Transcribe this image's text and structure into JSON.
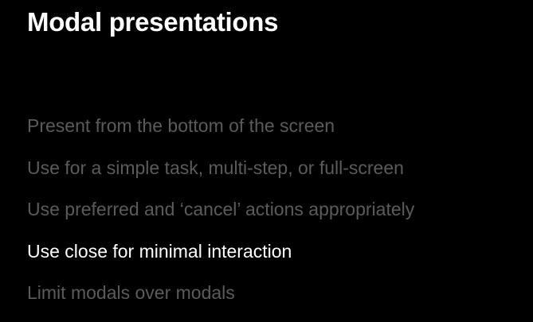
{
  "title": "Modal presentations",
  "bullets": [
    {
      "text": "Present from the bottom of the screen",
      "highlighted": false
    },
    {
      "text": "Use for a simple task, multi-step, or full-screen",
      "highlighted": false
    },
    {
      "text": "Use preferred and ‘cancel’ actions appropriately",
      "highlighted": false
    },
    {
      "text": "Use close for minimal interaction",
      "highlighted": true
    },
    {
      "text": "Limit modals over modals",
      "highlighted": false
    }
  ],
  "colors": {
    "background": "#000000",
    "title": "#ffffff",
    "bullet_dim": "#5b5b5b",
    "bullet_active": "#ffffff"
  }
}
